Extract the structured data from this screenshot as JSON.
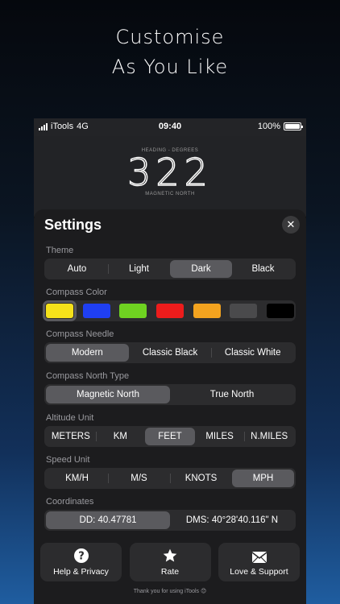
{
  "headline": {
    "line1": "Customise",
    "line2": "As You Like"
  },
  "status_bar": {
    "carrier": "iTools",
    "network": "4G",
    "time": "09:40",
    "battery": "100%"
  },
  "compass": {
    "top_caption": "HEADING - DEGREES",
    "heading": "322",
    "bottom_caption": "MAGNETIC NORTH"
  },
  "settings": {
    "title": "Settings",
    "theme": {
      "label": "Theme",
      "options": [
        "Auto",
        "Light",
        "Dark",
        "Black"
      ],
      "selected": "Dark"
    },
    "compass_color": {
      "label": "Compass Color",
      "swatches": [
        "#f5e11a",
        "#1f3ff2",
        "#6fd321",
        "#ed1c1c",
        "#f3a31f",
        "#4a4a4c",
        "#000000"
      ],
      "selected_index": 0
    },
    "compass_needle": {
      "label": "Compass Needle",
      "options": [
        "Modern",
        "Classic Black",
        "Classic White"
      ],
      "selected": "Modern"
    },
    "north_type": {
      "label": "Compass North Type",
      "options": [
        "Magnetic North",
        "True North"
      ],
      "selected": "Magnetic North"
    },
    "altitude_unit": {
      "label": "Altitude Unit",
      "options": [
        "METERS",
        "KM",
        "FEET",
        "MILES",
        "N.MILES"
      ],
      "selected": "FEET"
    },
    "speed_unit": {
      "label": "Speed Unit",
      "options": [
        "KM/H",
        "M/S",
        "KNOTS",
        "MPH"
      ],
      "selected": "MPH"
    },
    "coordinates": {
      "label": "Coordinates",
      "options": [
        "DD: 40.47781",
        "DMS: 40°28'40.116\" N"
      ],
      "selected": "DD: 40.47781"
    }
  },
  "actions": {
    "help": "Help & Privacy",
    "rate": "Rate",
    "support": "Love & Support"
  },
  "footer": "Thank you for using iTools 😊"
}
